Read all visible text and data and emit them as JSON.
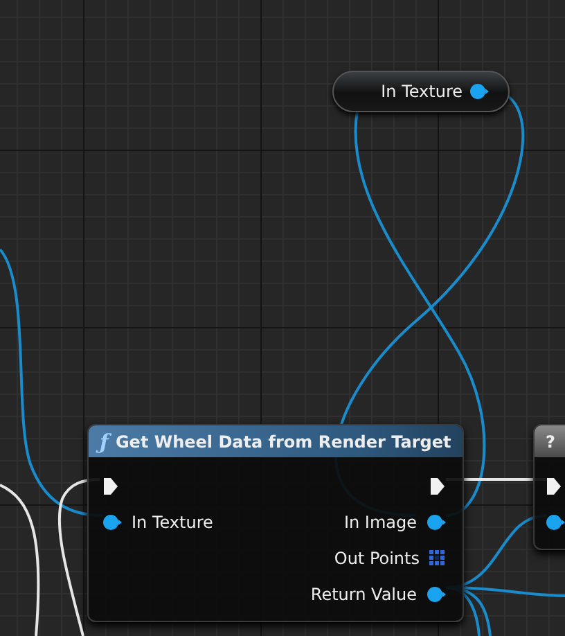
{
  "graph": {
    "nodes": [
      {
        "kind": "variable",
        "title": "In Texture"
      },
      {
        "kind": "function",
        "title": "Get Wheel Data from Render Target",
        "icon": "ƒ",
        "rows": [
          {
            "left": {
              "kind": "exec"
            },
            "right": {
              "kind": "exec"
            }
          },
          {
            "left": {
              "kind": "data",
              "label": "In Texture"
            },
            "right": {
              "kind": "data",
              "label": "In Image"
            }
          },
          {
            "right": {
              "kind": "array",
              "label": "Out Points"
            }
          },
          {
            "right": {
              "kind": "data",
              "label": "Return Value"
            }
          }
        ]
      },
      {
        "kind": "unknown",
        "title": "?",
        "rows": [
          {
            "left": {
              "kind": "exec"
            }
          },
          {
            "left": {
              "kind": "data"
            }
          }
        ]
      }
    ]
  }
}
